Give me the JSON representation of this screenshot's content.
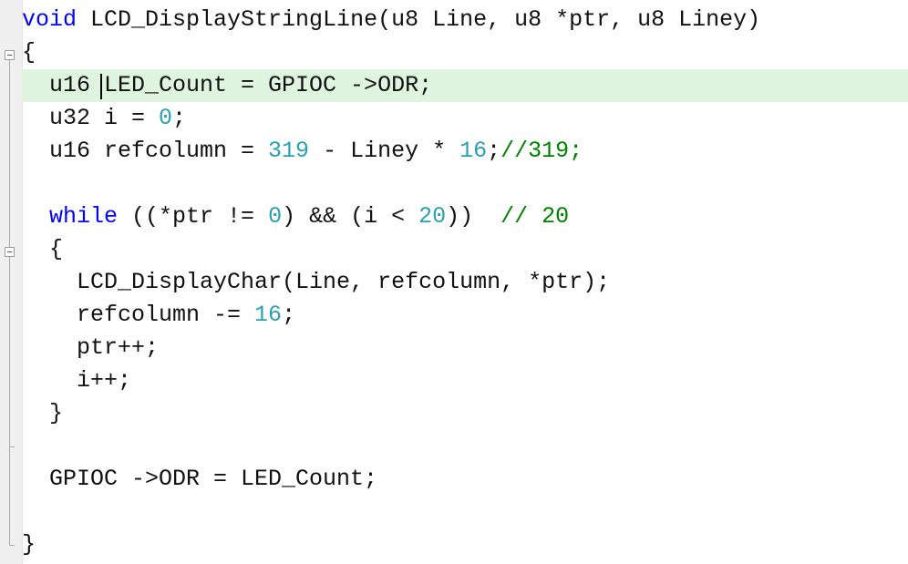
{
  "editor": {
    "lines": [
      {
        "name": "line-function-signature",
        "tokens": [
          {
            "t": "void",
            "c": "kw"
          },
          {
            "t": " LCD_DisplayStringLine(u8 Line, u8 *ptr, u8 Liney)",
            "c": ""
          }
        ]
      },
      {
        "name": "line-open-brace",
        "tokens": [
          {
            "t": "{",
            "c": ""
          }
        ]
      },
      {
        "name": "line-led-count-decl",
        "current": true,
        "tokens": [
          {
            "t": "  u16 LED_Count = GPIOC ->ODR;",
            "c": ""
          }
        ]
      },
      {
        "name": "line-i-decl",
        "tokens": [
          {
            "t": "  u32 i = ",
            "c": ""
          },
          {
            "t": "0",
            "c": "num"
          },
          {
            "t": ";",
            "c": ""
          }
        ]
      },
      {
        "name": "line-refcolumn-decl",
        "tokens": [
          {
            "t": "  u16 refcolumn = ",
            "c": ""
          },
          {
            "t": "319",
            "c": "num"
          },
          {
            "t": " - Liney * ",
            "c": ""
          },
          {
            "t": "16",
            "c": "num"
          },
          {
            "t": ";",
            "c": ""
          },
          {
            "t": "//319;",
            "c": "cmt"
          }
        ]
      },
      {
        "name": "line-blank-1",
        "tokens": []
      },
      {
        "name": "line-while",
        "tokens": [
          {
            "t": "  ",
            "c": ""
          },
          {
            "t": "while",
            "c": "kw"
          },
          {
            "t": " ((*ptr != ",
            "c": ""
          },
          {
            "t": "0",
            "c": "num"
          },
          {
            "t": ") && (i < ",
            "c": ""
          },
          {
            "t": "20",
            "c": "num"
          },
          {
            "t": "))  ",
            "c": ""
          },
          {
            "t": "// 20",
            "c": "cmt"
          }
        ]
      },
      {
        "name": "line-while-open-brace",
        "tokens": [
          {
            "t": "  {",
            "c": ""
          }
        ]
      },
      {
        "name": "line-display-char-call",
        "tokens": [
          {
            "t": "    LCD_DisplayChar(Line, refcolumn, *ptr);",
            "c": ""
          }
        ]
      },
      {
        "name": "line-refcolumn-decrement",
        "tokens": [
          {
            "t": "    refcolumn -= ",
            "c": ""
          },
          {
            "t": "16",
            "c": "num"
          },
          {
            "t": ";",
            "c": ""
          }
        ]
      },
      {
        "name": "line-ptr-increment",
        "tokens": [
          {
            "t": "    ptr++;",
            "c": ""
          }
        ]
      },
      {
        "name": "line-i-increment",
        "tokens": [
          {
            "t": "    i++;",
            "c": ""
          }
        ]
      },
      {
        "name": "line-while-close-brace",
        "tokens": [
          {
            "t": "  }",
            "c": ""
          }
        ]
      },
      {
        "name": "line-blank-2",
        "tokens": []
      },
      {
        "name": "line-odr-assign",
        "tokens": [
          {
            "t": "  GPIOC ->ODR = LED_Count;",
            "c": ""
          }
        ]
      },
      {
        "name": "line-blank-3",
        "tokens": []
      },
      {
        "name": "line-close-brace",
        "tokens": [
          {
            "t": "}",
            "c": ""
          }
        ]
      }
    ]
  }
}
